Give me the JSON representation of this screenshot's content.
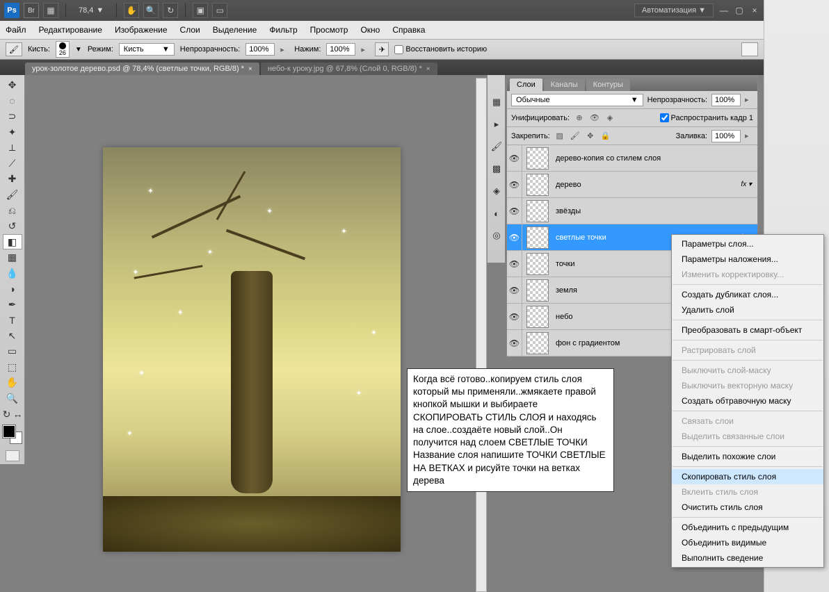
{
  "titlebar": {
    "zoom": "78,4",
    "auto_label": "Автоматизация ▼"
  },
  "menu": {
    "file": "Файл",
    "edit": "Редактирование",
    "image": "Изображение",
    "layer": "Слои",
    "select": "Выделение",
    "filter": "Фильтр",
    "view": "Просмотр",
    "window": "Окно",
    "help": "Справка"
  },
  "options": {
    "brush_label": "Кисть:",
    "brush_size": "26",
    "mode_label": "Режим:",
    "mode_value": "Кисть",
    "opacity_label": "Непрозрачность:",
    "opacity_value": "100%",
    "flow_label": "Нажим:",
    "flow_value": "100%",
    "restore_label": "Восстановить историю"
  },
  "tabs": {
    "t1": "урок-золотое дерево.psd @ 78,4% (светлые точки, RGB/8) *",
    "t2": "небо-к уроку.jpg @ 67,8% (Слой 0, RGB/8) *"
  },
  "panel_tabs": {
    "layers": "Слои",
    "channels": "Каналы",
    "paths": "Контуры"
  },
  "panel": {
    "blend_mode": "Обычные",
    "opacity_label": "Непрозрачность:",
    "opacity_value": "100%",
    "unify_label": "Унифицировать:",
    "propagate_label": "Распространить кадр 1",
    "lock_label": "Закрепить:",
    "fill_label": "Заливка:",
    "fill_value": "100%"
  },
  "layers": [
    {
      "name": "дерево-копия со стилем слоя",
      "fx": false
    },
    {
      "name": "дерево",
      "fx": true
    },
    {
      "name": "звёзды",
      "fx": false
    },
    {
      "name": "светлые точки",
      "fx": true,
      "selected": true
    },
    {
      "name": "точки",
      "fx": false
    },
    {
      "name": "земля",
      "fx": false
    },
    {
      "name": "небо",
      "fx": false
    },
    {
      "name": "фон с градиентом",
      "fx": false
    }
  ],
  "tooltip": "Когда всё готово..копируем стиль слоя который мы применяли..жмякаете правой кнопкой мышки и выбираете СКОПИРОВАТЬ СТИЛЬ СЛОЯ и находясь на слое..создаёте новый слой..Он получится над слоем СВЕТЛЫЕ ТОЧКИ\nНазвание слоя напишите ТОЧКИ СВЕТЛЫЕ НА ВЕТКАХ и рисуйте точки на ветках дерева",
  "context_menu": {
    "layer_props": "Параметры слоя...",
    "blend_opts": "Параметры наложения...",
    "edit_adj": "Изменить корректировку...",
    "dup": "Создать дубликат слоя...",
    "del": "Удалить слой",
    "smart": "Преобразовать в смарт-объект",
    "raster": "Растрировать слой",
    "dis_mask": "Выключить слой-маску",
    "dis_vmask": "Выключить векторную маску",
    "clip": "Создать обтравочную маску",
    "link": "Связать слои",
    "sel_linked": "Выделить связанные слои",
    "sel_similar": "Выделить похожие слои",
    "copy_style": "Скопировать стиль слоя",
    "paste_style": "Вклеить стиль слоя",
    "clear_style": "Очистить стиль слоя",
    "merge_prev": "Объединить с предыдущим",
    "merge_vis": "Объединить видимые",
    "flatten": "Выполнить сведение"
  }
}
